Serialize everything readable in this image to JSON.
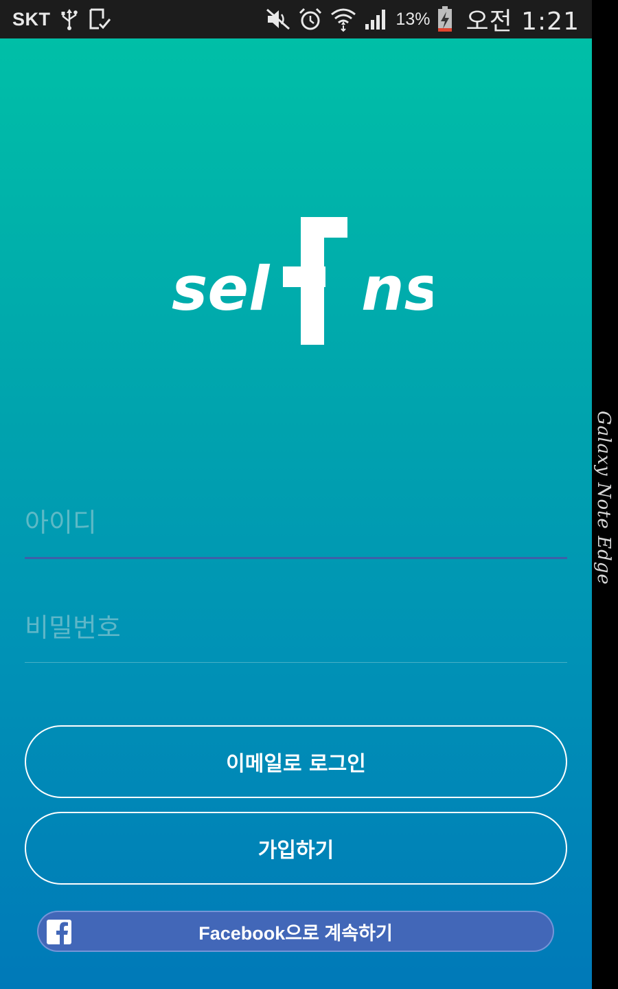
{
  "status_bar": {
    "carrier": "SKT",
    "battery_percent": "13%",
    "time": "오전 1:21",
    "icons": [
      "usb-icon",
      "screenshot-icon",
      "mute-icon",
      "alarm-icon",
      "wifi-icon",
      "signal-icon",
      "battery-charging-icon"
    ]
  },
  "logo": {
    "text_left": "sel",
    "text_right": "ns",
    "mark_letter": "f"
  },
  "login_form": {
    "id_placeholder": "아이디",
    "id_value": "",
    "password_placeholder": "비밀번호",
    "password_value": ""
  },
  "buttons": {
    "email_login": "이메일로 로그인",
    "signup": "가입하기",
    "facebook": "Facebook으로 계속하기"
  },
  "device": {
    "edge_label": "Galaxy Note Edge"
  },
  "colors": {
    "gradient_top": "#00bfa7",
    "gradient_bottom": "#0079b8",
    "facebook_blue": "#4267b8",
    "active_underline": "#3f5fa8"
  }
}
